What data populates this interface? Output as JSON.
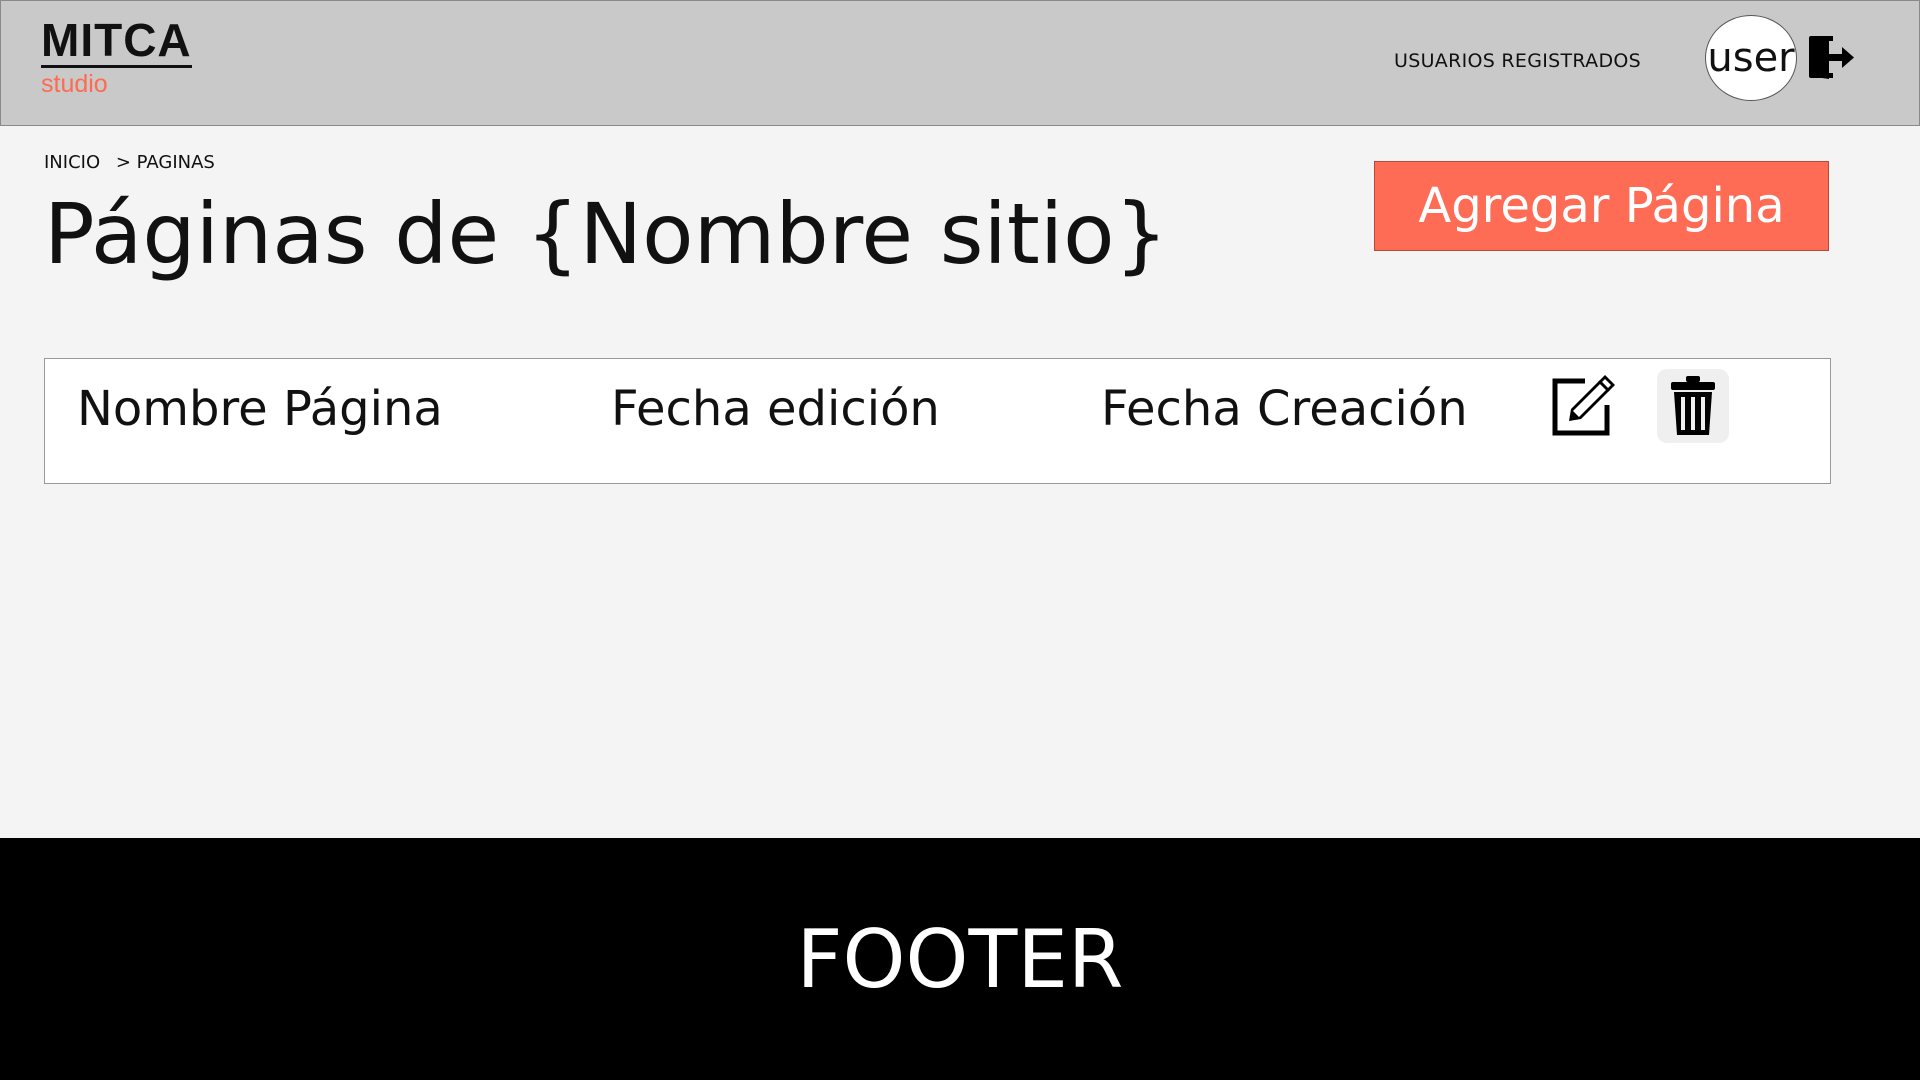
{
  "header": {
    "logo_main": "MITCA",
    "logo_sub": "studio",
    "nav_link": "USUARIOS REGISTRADOS",
    "avatar_label": "user",
    "logout_icon": "logout-icon"
  },
  "breadcrumb": {
    "items": [
      "INICIO",
      "> PAGINAS"
    ]
  },
  "main": {
    "title": "Páginas de {Nombre sitio}",
    "add_button_label": "Agregar Página"
  },
  "table": {
    "columns": [
      "Nombre Página",
      "Fecha edición",
      "Fecha Creación"
    ],
    "actions": [
      "edit-icon",
      "trash-icon"
    ]
  },
  "footer": {
    "label": "FOOTER"
  },
  "colors": {
    "header_bg": "#c9c9c9",
    "accent": "#ff6c56",
    "logo_sub": "#ff6a50",
    "body_bg": "#f4f4f4",
    "footer_bg": "#000000"
  }
}
